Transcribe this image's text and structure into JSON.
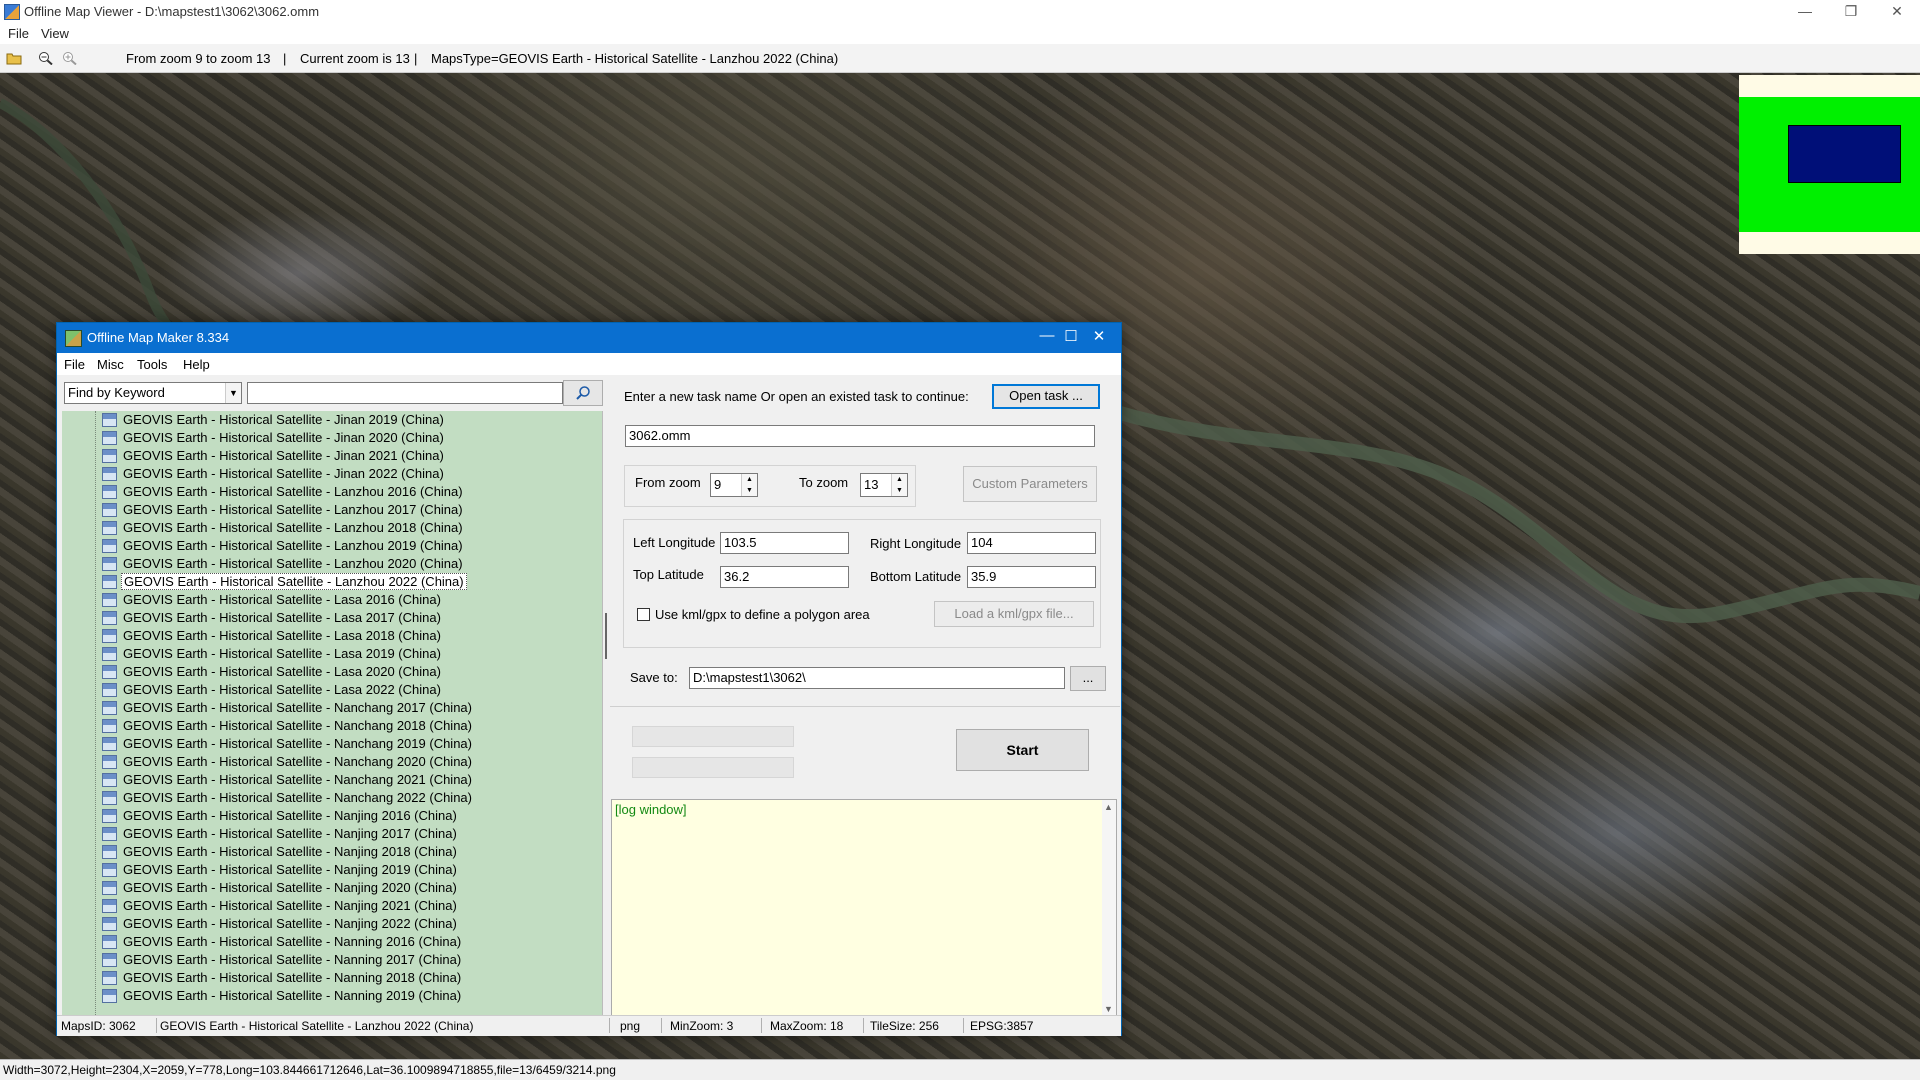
{
  "viewer": {
    "title": "Offline Map Viewer - D:\\mapstest1\\3062\\3062.omm",
    "menu": [
      "File",
      "View"
    ],
    "toolbar": {
      "zoom_range": "From zoom 9 to zoom 13",
      "current_zoom": "Current zoom is 13",
      "maps_type": "MapsType=GEOVIS Earth - Historical Satellite - Lanzhou 2022 (China)",
      "sep": "|"
    },
    "status": "Width=3072,Height=2304,X=2059,Y=778,Long=103.844661712646,Lat=36.1009894718855,file=13/6459/3214.png"
  },
  "maker": {
    "title": "Offline Map Maker 8.334",
    "menu": [
      "File",
      "Misc",
      "Tools",
      "Help"
    ],
    "find_mode": "Find by Keyword",
    "search_value": "",
    "tree_items": [
      "GEOVIS Earth - Historical Satellite - Jinan 2019 (China)",
      "GEOVIS Earth - Historical Satellite - Jinan 2020 (China)",
      "GEOVIS Earth - Historical Satellite - Jinan 2021 (China)",
      "GEOVIS Earth - Historical Satellite - Jinan 2022 (China)",
      "GEOVIS Earth - Historical Satellite - Lanzhou 2016 (China)",
      "GEOVIS Earth - Historical Satellite - Lanzhou 2017 (China)",
      "GEOVIS Earth - Historical Satellite - Lanzhou 2018 (China)",
      "GEOVIS Earth - Historical Satellite - Lanzhou 2019 (China)",
      "GEOVIS Earth - Historical Satellite - Lanzhou 2020 (China)",
      "GEOVIS Earth - Historical Satellite - Lanzhou 2022 (China)",
      "GEOVIS Earth - Historical Satellite - Lasa 2016 (China)",
      "GEOVIS Earth - Historical Satellite - Lasa 2017 (China)",
      "GEOVIS Earth - Historical Satellite - Lasa 2018 (China)",
      "GEOVIS Earth - Historical Satellite - Lasa 2019 (China)",
      "GEOVIS Earth - Historical Satellite - Lasa 2020 (China)",
      "GEOVIS Earth - Historical Satellite - Lasa 2022 (China)",
      "GEOVIS Earth - Historical Satellite - Nanchang 2017 (China)",
      "GEOVIS Earth - Historical Satellite - Nanchang 2018 (China)",
      "GEOVIS Earth - Historical Satellite - Nanchang 2019 (China)",
      "GEOVIS Earth - Historical Satellite - Nanchang 2020 (China)",
      "GEOVIS Earth - Historical Satellite - Nanchang 2021 (China)",
      "GEOVIS Earth - Historical Satellite - Nanchang 2022 (China)",
      "GEOVIS Earth - Historical Satellite - Nanjing 2016 (China)",
      "GEOVIS Earth - Historical Satellite - Nanjing 2017 (China)",
      "GEOVIS Earth - Historical Satellite - Nanjing 2018 (China)",
      "GEOVIS Earth - Historical Satellite - Nanjing 2019 (China)",
      "GEOVIS Earth - Historical Satellite - Nanjing 2020 (China)",
      "GEOVIS Earth - Historical Satellite - Nanjing 2021 (China)",
      "GEOVIS Earth - Historical Satellite - Nanjing 2022 (China)",
      "GEOVIS Earth - Historical Satellite - Nanning 2016 (China)",
      "GEOVIS Earth - Historical Satellite - Nanning 2017 (China)",
      "GEOVIS Earth - Historical Satellite - Nanning 2018 (China)",
      "GEOVIS Earth - Historical Satellite - Nanning 2019 (China)"
    ],
    "selected_item": "GEOVIS Earth - Historical Satellite - Lanzhou 2022 (China)",
    "task_prompt": "Enter a new task name Or open an existed task to continue:",
    "open_task_label": "Open task ...",
    "task_name": "3062.omm",
    "from_zoom_label": "From zoom",
    "from_zoom": "9",
    "to_zoom_label": "To zoom",
    "to_zoom": "13",
    "custom_params_label": "Custom Parameters",
    "left_lon_label": "Left Longitude",
    "left_lon": "103.5",
    "right_lon_label": "Right Longitude",
    "right_lon": "104",
    "top_lat_label": "Top Latitude",
    "top_lat": "36.2",
    "bottom_lat_label": "Bottom Latitude",
    "bottom_lat": "35.9",
    "kml_label": "Use kml/gpx to define a polygon area",
    "kml_checked": false,
    "load_kml_label": "Load a kml/gpx file...",
    "save_to_label": "Save to:",
    "save_to": "D:\\mapstest1\\3062\\",
    "browse_label": "...",
    "start_label": "Start",
    "log_text": "[log window]",
    "status": {
      "maps_id": "MapsID: 3062",
      "maps_name": "GEOVIS Earth - Historical Satellite - Lanzhou 2022 (China)",
      "format": "png",
      "min_zoom": "MinZoom: 3",
      "max_zoom": "MaxZoom: 18",
      "tile_size": "TileSize: 256",
      "epsg": "EPSG:3857"
    }
  },
  "colors": {
    "dialog_title_bg": "#0a6fd0",
    "tree_bg": "#c2ddc2",
    "log_bg": "#ffffe1",
    "minimap_green": "#00f000",
    "minimap_blue": "#000f78"
  },
  "icons": [
    "open-folder-icon",
    "zoom-out-icon",
    "zoom-in-icon",
    "search-icon",
    "minimize-icon",
    "maximize-icon",
    "close-icon",
    "restore-icon"
  ]
}
